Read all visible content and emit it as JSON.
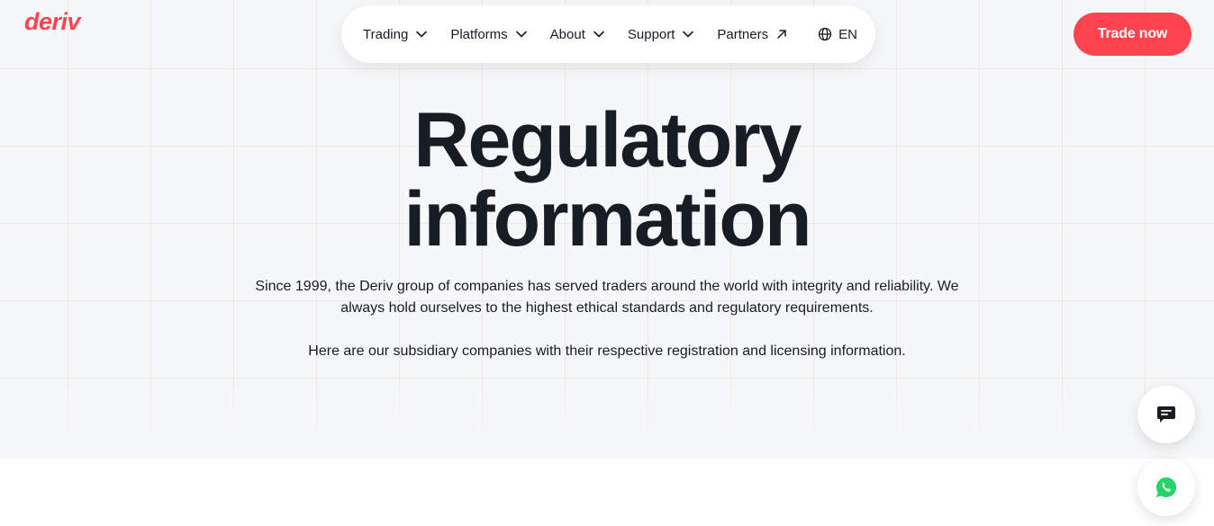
{
  "brand": {
    "logo_text": "deriv",
    "accent_color": "#ff444f"
  },
  "nav": {
    "items": [
      {
        "label": "Trading",
        "icon": "chevron-down-icon"
      },
      {
        "label": "Platforms",
        "icon": "chevron-down-icon"
      },
      {
        "label": "About",
        "icon": "chevron-down-icon"
      },
      {
        "label": "Support",
        "icon": "chevron-down-icon"
      },
      {
        "label": "Partners",
        "icon": "arrow-up-right-icon"
      }
    ],
    "language": {
      "label": "EN",
      "icon": "globe-icon"
    }
  },
  "header": {
    "cta_label": "Trade now"
  },
  "hero": {
    "title_line1": "Regulatory",
    "title_line2": "information",
    "description": "Since 1999, the Deriv group of companies has served traders around the world with integrity and reliability. We always hold ourselves to the highest ethical standards and regulatory requirements.",
    "subtext": "Here are our subsidiary companies with their respective registration and licensing information."
  },
  "floating_actions": {
    "chat_icon": "chat-icon",
    "whatsapp_icon": "whatsapp-icon",
    "whatsapp_color": "#25d366"
  }
}
